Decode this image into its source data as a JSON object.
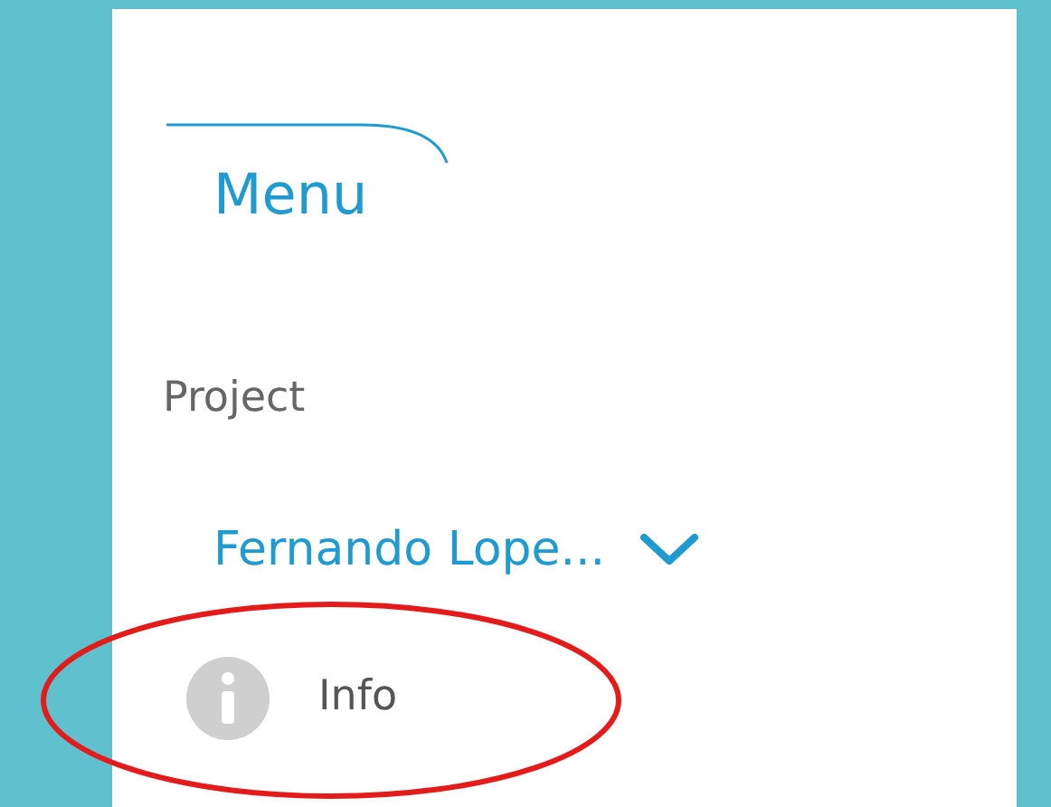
{
  "menu": {
    "title": "Menu"
  },
  "project": {
    "label": "Project",
    "name": "Fernando Lope..."
  },
  "items": [
    {
      "label": "Info",
      "highlighted": true
    }
  ]
}
